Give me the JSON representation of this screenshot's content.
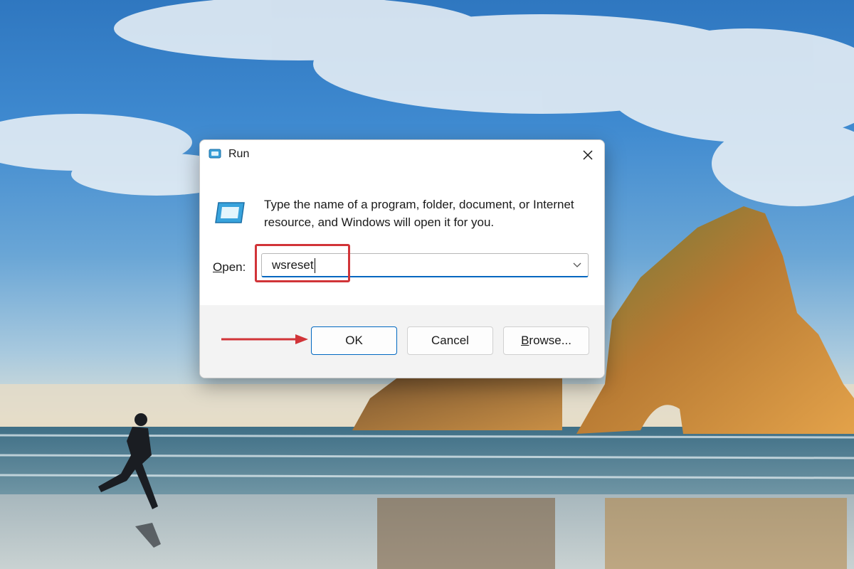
{
  "dialog": {
    "title": "Run",
    "description": "Type the name of a program, folder, document, or Internet resource, and Windows will open it for you.",
    "open_label_accel": "O",
    "open_label_rest": "pen:",
    "open_value": "wsreset",
    "buttons": {
      "ok": "OK",
      "cancel": "Cancel",
      "browse_accel": "B",
      "browse_rest": "rowse..."
    }
  },
  "annotations": {
    "highlight_color": "#d13438",
    "arrow_color": "#d13438"
  },
  "icons": {
    "title": "run-app-icon",
    "body": "run-app-icon",
    "close": "close-icon",
    "dropdown": "chevron-down-icon"
  },
  "colors": {
    "accent": "#0067c0",
    "dialog_bg": "#ffffff",
    "footer_bg": "#f3f3f3"
  }
}
